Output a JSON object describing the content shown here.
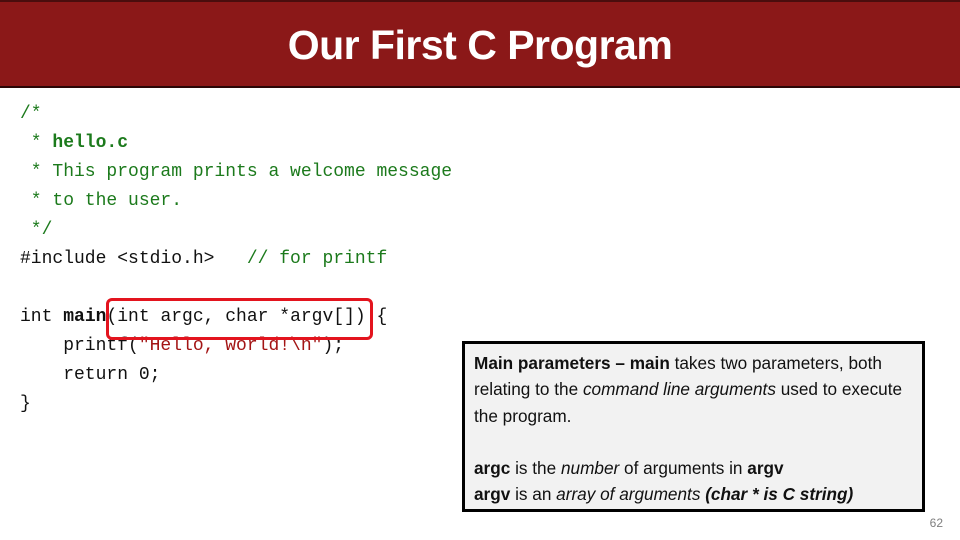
{
  "slide": {
    "title": "Our First C Program",
    "page_number": "62",
    "colors": {
      "title_bar": "#8b1818",
      "comment": "#1c7a1c",
      "string": "#a31515",
      "highlight": "#e3141e",
      "callout_bg": "#f2f2f2"
    }
  },
  "code": {
    "l1": "/*",
    "l2_prefix": " * ",
    "l2_filename": "hello.c",
    "l3": " * This program prints a welcome message",
    "l4": " * to the user.",
    "l5": " */",
    "l6_code": "#include <stdio.h>   ",
    "l6_comment": "// for printf",
    "l7": "",
    "l8_type": "int ",
    "l8_func": "main",
    "l8_params": "(int argc, char *argv[])",
    "l8_end": " {",
    "l9_indent": "    printf(",
    "l9_string": "\"Hello, world!\\n\"",
    "l9_end": ");",
    "l10": "    return 0;",
    "l11": "}"
  },
  "callout": {
    "p1_bold": "Main parameters – main",
    "p1_rest1": " takes two parameters, both relating to the ",
    "p1_italic": "command line arguments",
    "p1_rest2": " used to execute the program.",
    "p2_b1": "argc",
    "p2_t1": " is the ",
    "p2_i1": "number",
    "p2_t2": " of arguments in ",
    "p2_b2": "argv",
    "p3_b1": "argv",
    "p3_t1": " is an ",
    "p3_i1": "array of arguments",
    "p3_t2": " ",
    "p3_bi": "(char * is C string)"
  }
}
